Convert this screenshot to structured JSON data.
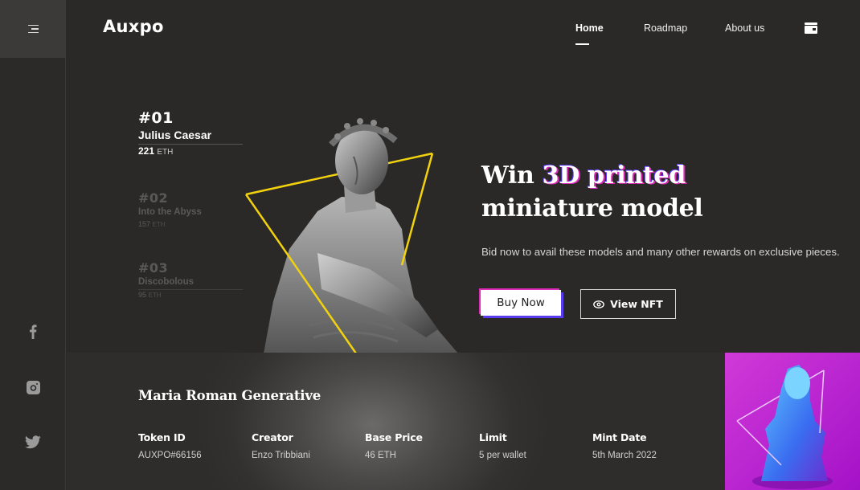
{
  "brand": {
    "logo": "Auxpo"
  },
  "nav": {
    "items": [
      {
        "label": "Home",
        "active": true
      },
      {
        "label": "Roadmap",
        "active": false
      },
      {
        "label": "About us",
        "active": false
      }
    ],
    "wallet_icon": "wallet-icon"
  },
  "sidebar": {
    "menu_icon": "menu-icon",
    "socials": [
      "facebook-icon",
      "instagram-icon",
      "twitter-icon"
    ]
  },
  "collection": [
    {
      "num": "#01",
      "name": "Julius Caesar",
      "price": "221",
      "unit": "ETH"
    },
    {
      "num": "#02",
      "name": "Into the Abyss",
      "price": "157",
      "unit": "ETH"
    },
    {
      "num": "#03",
      "name": "Discobolous",
      "price": "95",
      "unit": "ETH"
    }
  ],
  "hero": {
    "title_pre": "Win ",
    "title_highlight": "3D printed",
    "title_line2": "miniature model",
    "subtitle": "Bid now to avail these models and many other rewards on exclusive pieces.",
    "buy_label": "Buy Now",
    "view_label": "View NFT"
  },
  "details": {
    "title": "Maria Roman Generative",
    "fields": [
      {
        "label": "Token ID",
        "value": "AUXPO#66156"
      },
      {
        "label": "Creator",
        "value": "Enzo Tribbiani"
      },
      {
        "label": "Base Price",
        "value": "46 ETH"
      },
      {
        "label": "Limit",
        "value": "5 per wallet"
      },
      {
        "label": "Mint Date",
        "value": "5th March 2022"
      }
    ]
  },
  "colors": {
    "accent_yellow": "#f2d20f",
    "accent_pink": "#e02ab8",
    "accent_purple": "#5a3cf0",
    "background": "#2a2928"
  }
}
